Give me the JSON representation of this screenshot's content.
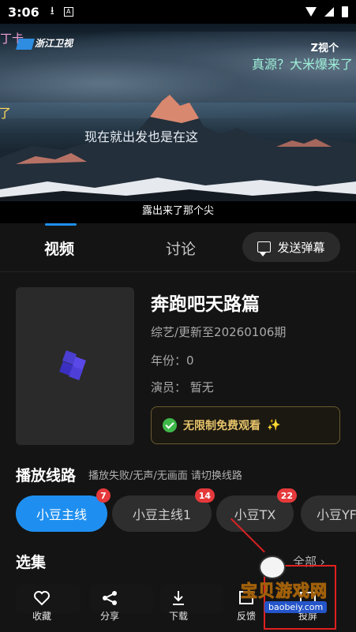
{
  "status_bar": {
    "time": "3:06"
  },
  "video": {
    "top_left_text": "丁卡",
    "channel_logo": "浙江卫视",
    "top_right_logo": "Z视个",
    "danmaku": [
      "真源？大米爆来了",
      "了",
      "现在就出发也是在这"
    ],
    "subtitle": "露出来了那个尖"
  },
  "tabs": {
    "video": "视频",
    "discuss": "讨论",
    "send_danmaku": "发送弹幕"
  },
  "info": {
    "title": "奔跑吧天路篇",
    "category": "综艺/更新至20260106期",
    "year": "年份：0",
    "actors": "演员：  暂无",
    "free_banner": "无限制免费观看"
  },
  "lines": {
    "title": "播放线路",
    "note": "播放失败/无声/无画面 请切换线路",
    "items": [
      {
        "label": "小豆主线",
        "count": "7"
      },
      {
        "label": "小豆主线1",
        "count": "14"
      },
      {
        "label": "小豆TX",
        "count": "22"
      },
      {
        "label": "小豆YF",
        "count": ""
      }
    ]
  },
  "episodes": {
    "title": "选集",
    "all": "全部 ›"
  },
  "actions": [
    "收藏",
    "分享",
    "下载",
    "反馈",
    "投屏"
  ],
  "watermark": {
    "text": "宝贝游戏网",
    "url": "baobeiy.com"
  },
  "colors": {
    "accent": "#1e8ff0",
    "badge": "#e5393b",
    "free_text": "#e8c56b",
    "free_check": "#3fb84a"
  }
}
